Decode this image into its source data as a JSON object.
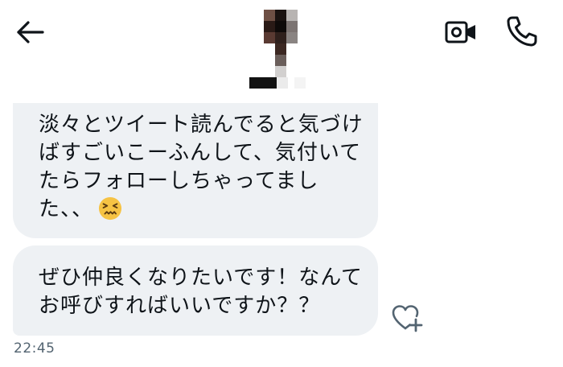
{
  "header": {
    "back_icon": "back-arrow-icon",
    "video_icon": "video-camera-icon",
    "call_icon": "phone-icon"
  },
  "messages": [
    {
      "lines": [
        "淡々とツイート読んでると気づけ",
        "ばすごいこーふんして、気付いて",
        "たらフォローしちゃってまし",
        "た、、"
      ],
      "emoji": "confounded-face-emoji"
    },
    {
      "lines": [
        "ぜひ仲良くなりたいです！なんて",
        "お呼びすればいいですか？？"
      ]
    }
  ],
  "reaction_icon": "heart-plus-icon",
  "timestamp": "22:45",
  "colors": {
    "bubble": "#eef1f4",
    "text": "#0f1419",
    "muted": "#536471",
    "emoji": "#f6c344"
  }
}
